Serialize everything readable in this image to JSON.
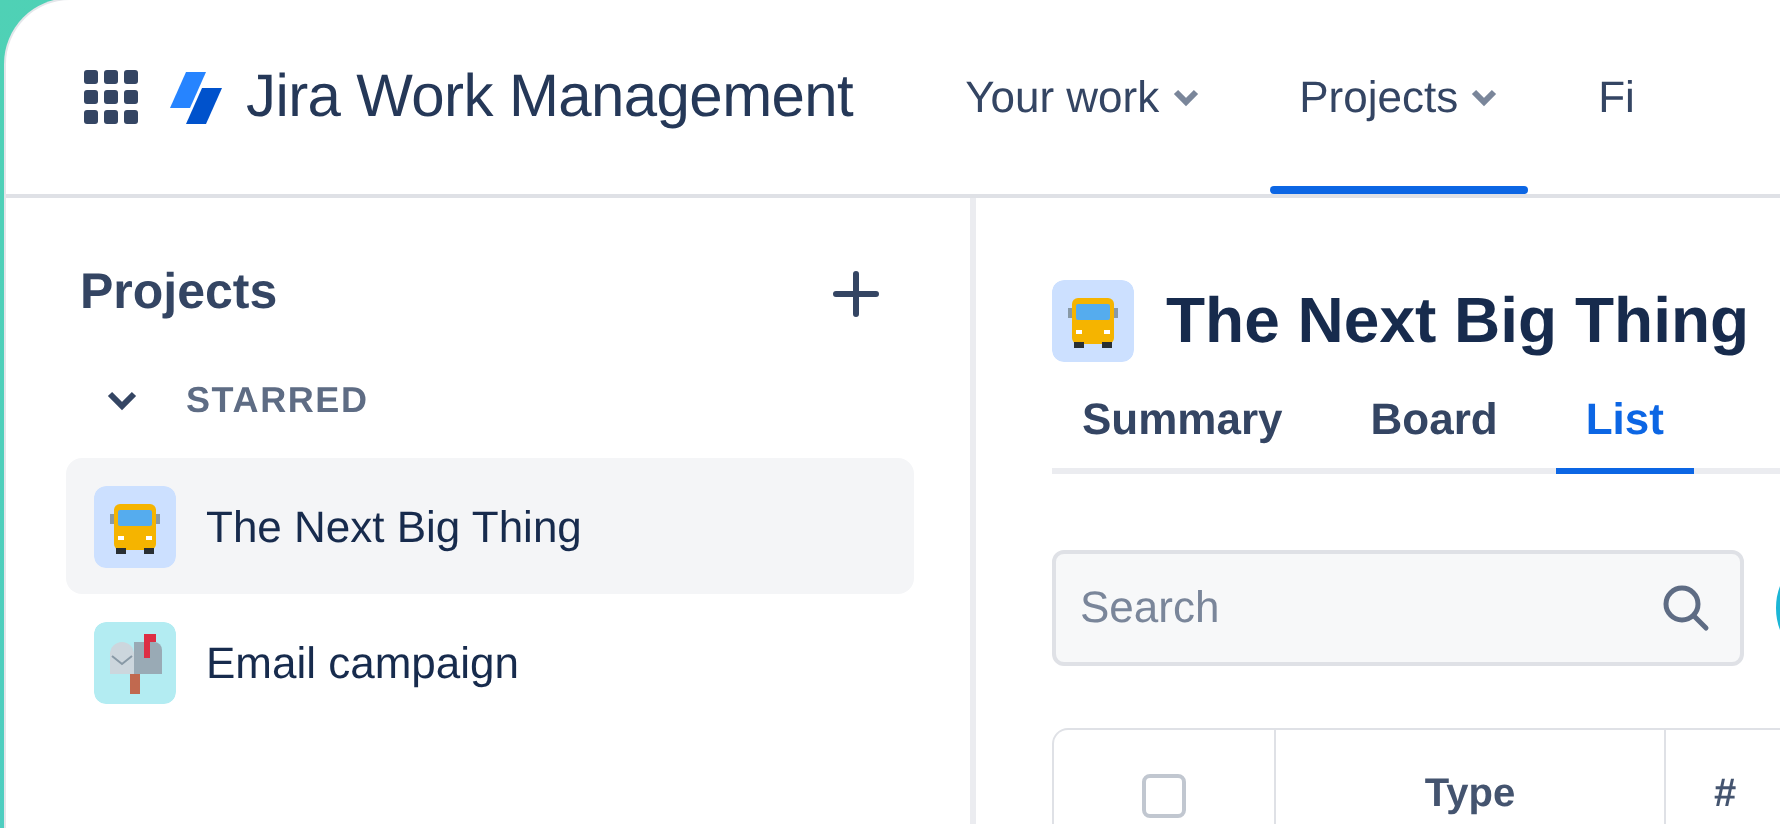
{
  "app": {
    "name": "Jira Work Management"
  },
  "nav": [
    {
      "label": "Your work",
      "dropdown": true,
      "selected": false
    },
    {
      "label": "Projects",
      "dropdown": true,
      "selected": true
    },
    {
      "label": "Fi",
      "dropdown": false,
      "selected": false
    }
  ],
  "sidebar": {
    "title": "Projects",
    "section": {
      "label": "STARRED",
      "expanded": true
    },
    "items": [
      {
        "label": "The Next Big Thing",
        "kind": "bus",
        "selected": true
      },
      {
        "label": "Email campaign",
        "kind": "mailbox",
        "selected": false
      }
    ]
  },
  "project": {
    "title": "The Next Big Thing",
    "kind": "bus",
    "tabs": [
      {
        "label": "Summary",
        "selected": false
      },
      {
        "label": "Board",
        "selected": false
      },
      {
        "label": "List",
        "selected": true
      }
    ],
    "search": {
      "placeholder": "Search"
    },
    "table": {
      "select_all": {
        "checked": false
      },
      "columns": [
        "Type",
        "#"
      ]
    }
  }
}
